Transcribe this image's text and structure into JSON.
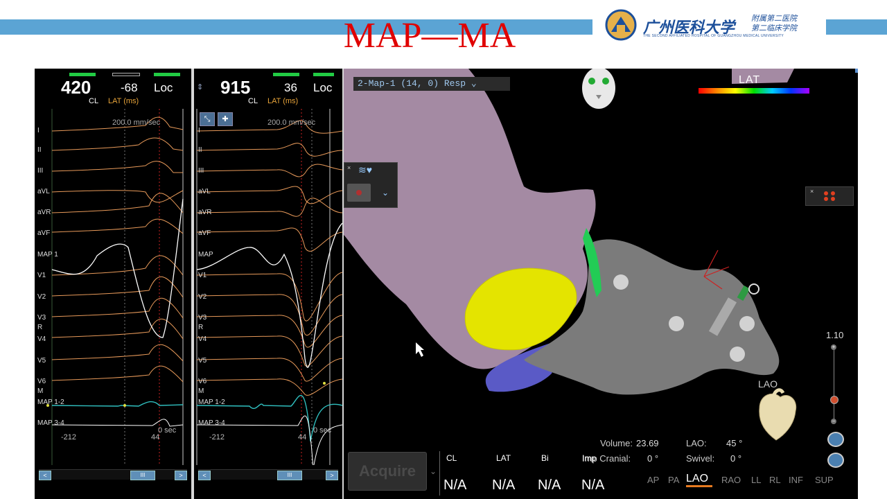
{
  "slide": {
    "title": "MAP—MA",
    "logo_cn": "广州医科大学",
    "logo_sub1": "附属第二医院",
    "logo_sub2": "第二临床学院",
    "logo_en": "THE SECOND AFFILIATED HOSPITAL OF GUANGZHOU MEDICAL UNIVERSITY"
  },
  "panel1": {
    "cl_value": "420",
    "lat_value": "-68",
    "loc_label": "Loc",
    "cl_label": "CL",
    "lat_label": "LAT (ms)",
    "speed": "200.0 mm/sec",
    "leads": [
      "I",
      "II",
      "III",
      "aVL",
      "aVR",
      "aVF",
      "MAP 1",
      "V1",
      "V2",
      "V3",
      "R",
      "V4",
      "V5",
      "V6",
      "M",
      "MAP 1-2",
      "MAP 3-4"
    ],
    "foot_left": "-212",
    "foot_mid": "44",
    "foot_right": "0 sec",
    "scroll_label": "III"
  },
  "panel2": {
    "cl_value": "915",
    "lat_value": "36",
    "loc_label": "Loc",
    "cl_label": "CL",
    "lat_label": "LAT (ms)",
    "speed": "200.0 mm/sec",
    "leads": [
      "I",
      "II",
      "III",
      "aVL",
      "aVR",
      "aVF",
      "MAP",
      "V1",
      "V2",
      "V3",
      "R",
      "V4",
      "V5",
      "V6",
      "M",
      "MAP 1-2",
      "MAP 3-4"
    ],
    "foot_left": "-212",
    "foot_mid": "44",
    "foot_right": "0 sec",
    "scroll_label": "III"
  },
  "map": {
    "selector": "2-Map-1 (14, 0) Resp",
    "lat_legend": "LAT",
    "zoom_value": "1.10",
    "view_label": "LAO",
    "stats": {
      "volume_label": "Volume:",
      "volume_value": "23.69",
      "imp_label": "Imp Cranial:",
      "imp_value": "0 °",
      "lao_label": "LAO:",
      "lao_value": "45 °",
      "swivel_label": "Swivel:",
      "swivel_value": "0 °"
    },
    "acquire_label": "Acquire",
    "columns": [
      {
        "header": "CL",
        "value": "N/A"
      },
      {
        "header": "LAT",
        "value": "N/A"
      },
      {
        "header": "Bi",
        "value": "N/A"
      },
      {
        "header": "Imp",
        "value": "N/A"
      }
    ],
    "views": [
      "AP",
      "PA",
      "LAO",
      "RAO",
      "LL",
      "RL",
      "INF",
      "SUP"
    ],
    "active_view": "LAO",
    "colors": {
      "chamber": "#a48aa3",
      "secondary_chamber": "#7b7b7b",
      "valve": "#e4e400",
      "accent": "#e87b20"
    }
  }
}
